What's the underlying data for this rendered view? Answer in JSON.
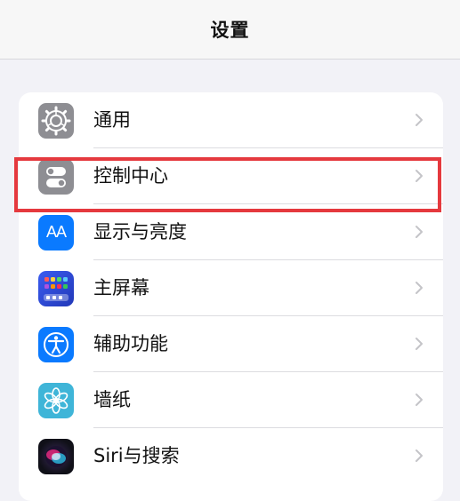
{
  "navbar": {
    "title": "设置"
  },
  "settings": {
    "items": [
      {
        "label": "通用",
        "icon": "gear-icon",
        "color": "#8e8e93"
      },
      {
        "label": "控制中心",
        "icon": "toggles-icon",
        "color": "#8e8e93"
      },
      {
        "label": "显示与亮度",
        "icon": "display-brightness-icon",
        "icon_text": "AA",
        "color": "#0a7aff"
      },
      {
        "label": "主屏幕",
        "icon": "home-screen-icon",
        "color": "#2b4ed8"
      },
      {
        "label": "辅助功能",
        "icon": "accessibility-icon",
        "color": "#0a7aff"
      },
      {
        "label": "墙纸",
        "icon": "wallpaper-flower-icon",
        "color": "#3fb5d8"
      },
      {
        "label": "Siri与搜索",
        "icon": "siri-icon",
        "color": "#1c1c2e"
      }
    ]
  },
  "highlight": {
    "color": "#e5393e",
    "target": "控制中心"
  }
}
